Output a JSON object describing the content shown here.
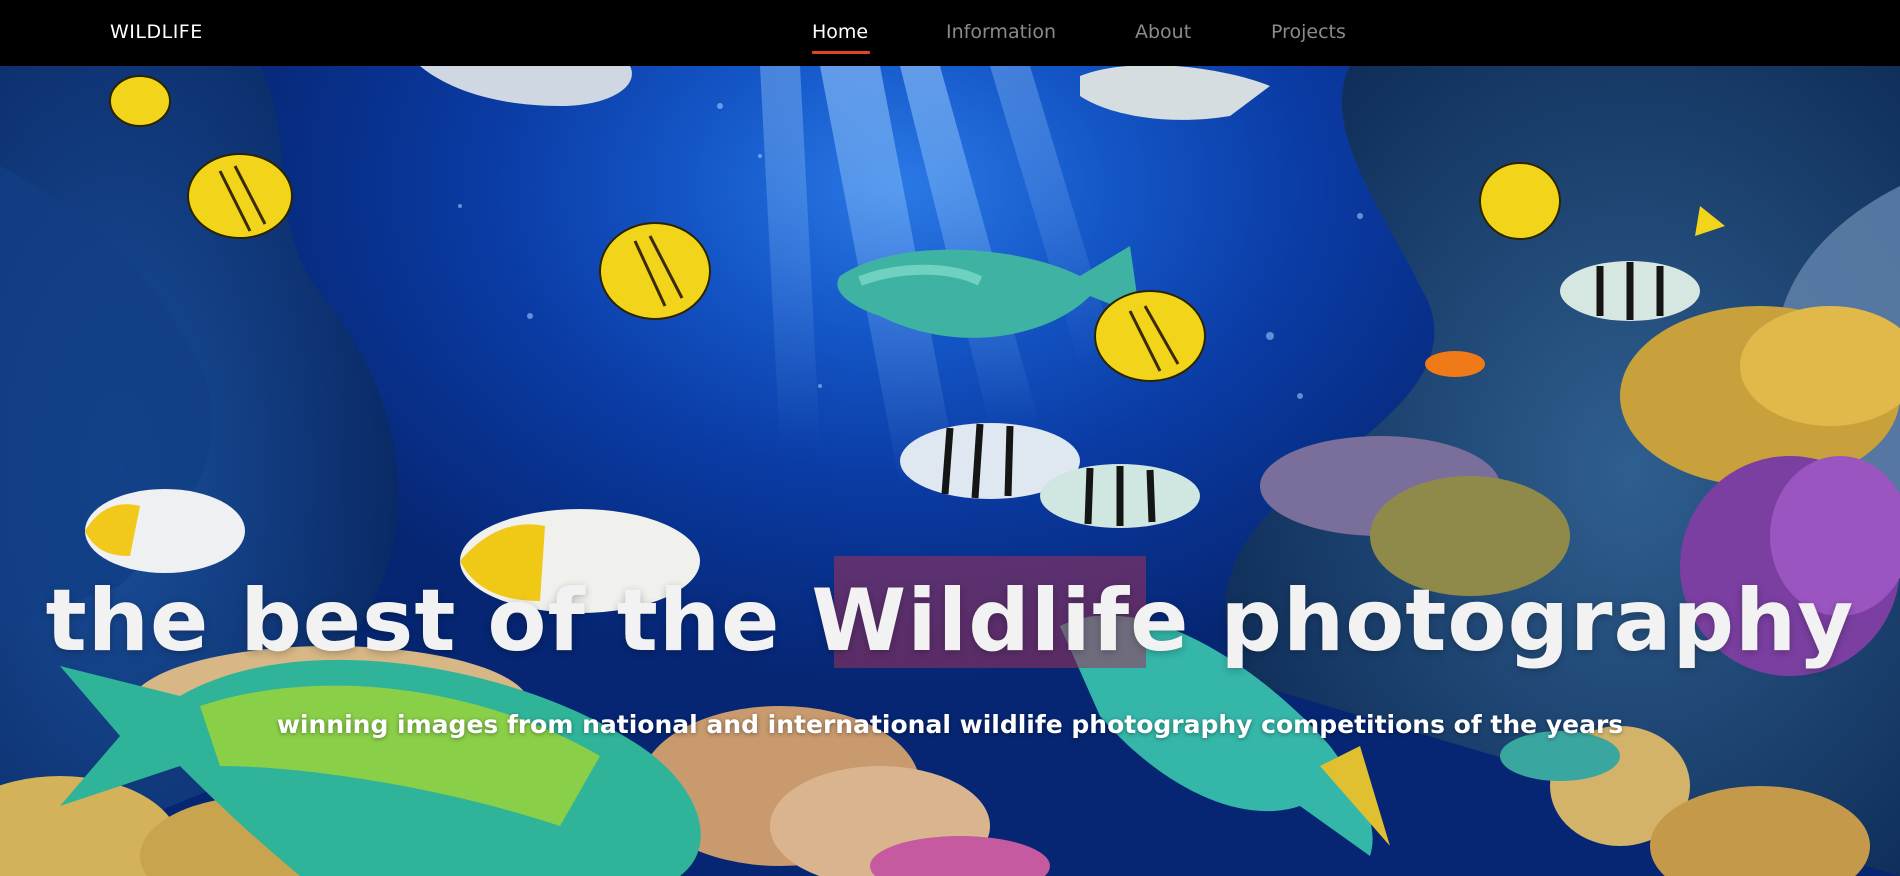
{
  "navbar": {
    "brand": "WILDLIFE",
    "items": [
      {
        "label": "Home",
        "active": true
      },
      {
        "label": "Information",
        "active": false
      },
      {
        "label": "About",
        "active": false
      },
      {
        "label": "Projects",
        "active": false
      }
    ],
    "active_underline_color": "#e3461e"
  },
  "hero": {
    "title": "the best of the Wildlife photography",
    "subtitle": "winning images from national and international wildlife photography competitions of the years",
    "background_scene": "underwater-coral-reef-with-tropical-fish",
    "water_color": "#1456c7"
  }
}
